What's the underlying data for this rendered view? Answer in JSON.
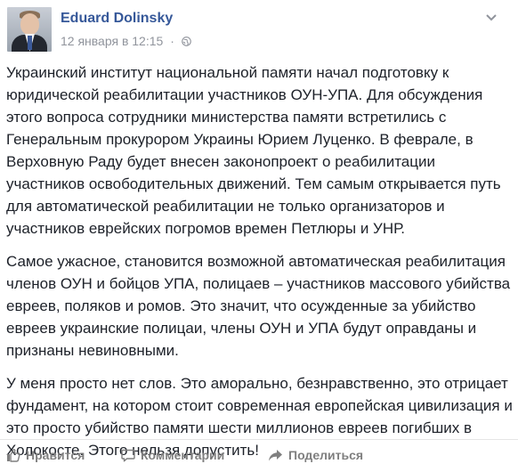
{
  "post": {
    "author": "Eduard Dolinsky",
    "timestamp": "12 января в 12:15",
    "separator": "·",
    "privacy_icon": "globe-icon",
    "paragraphs": [
      "Украинский институт национальной памяти начал подготовку к юридической реабилитации участников ОУН-УПА. Для обсуждения этого вопроса сотрудники министерства памяти встретились с Генеральным прокурором Украины Юрием Луценко. В феврале, в Верховную Раду будет внесен законопроект о реабилитации участников освободительных движений. Тем самым открывается путь для автоматической реабилитации не только организаторов и участников еврейских погромов времен Петлюры и УНР.",
      "Самое ужасное, становится возможной автоматическая реабилитация членов ОУН и бойцов УПА, полицаев – участников массового убийства евреев, поляков и ромов. Это значит, что осужденные за убийство евреев украинские полицаи, члены ОУН и УПА будут оправданы и признаны невиновными.",
      "У меня просто нет слов. Это аморально, безнравственно, это отрицает фундамент, на котором стоит современная европейская цивилизация и это просто убийство памяти шести миллионов евреев погибших в Холокосте. Этого нельзя допустить!"
    ]
  },
  "actions": {
    "like_label": "Нравится",
    "comment_label": "Комментарии",
    "share_label": "Поделиться"
  },
  "colors": {
    "author": "#365899",
    "meta": "#90949c",
    "text": "#1d2129",
    "action": "#7f7f7f"
  }
}
